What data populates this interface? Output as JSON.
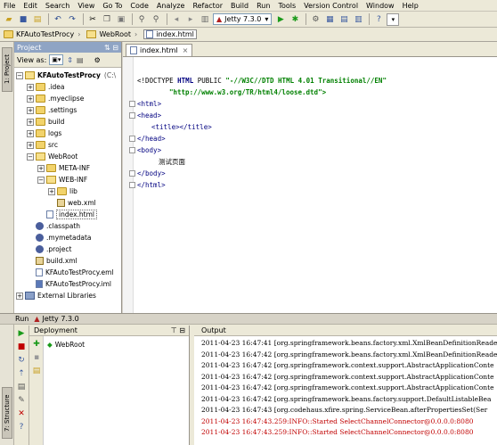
{
  "menu": [
    "File",
    "Edit",
    "Search",
    "View",
    "Go To",
    "Code",
    "Analyze",
    "Refactor",
    "Build",
    "Run",
    "Tools",
    "Version Control",
    "Window",
    "Help"
  ],
  "toolbar": {
    "run_config": "Jetty 7.3.0"
  },
  "breadcrumb": {
    "project": "KFAutoTestProcy",
    "folder": "WebRoot",
    "file": "index.html"
  },
  "sidebar": {
    "project_tab": "1: Project",
    "structure_tab": "7: Structure"
  },
  "project_panel": {
    "title": "Project",
    "view_as_label": "View as:",
    "root": "KFAutoTestProcy",
    "root_suffix": "(C:\\",
    "items": [
      ".idea",
      ".myeclipse",
      ".settings",
      "build",
      "logs",
      "src",
      "WebRoot",
      "META-INF",
      "WEB-INF",
      "lib",
      "web.xml",
      "index.html",
      ".classpath",
      ".mymetadata",
      ".project",
      "build.xml",
      "KFAutoTestProcy.eml",
      "KFAutoTestProcy.iml",
      "External Libraries"
    ]
  },
  "editor": {
    "tab": "index.html",
    "lines": {
      "doctype": "<!DOCTYPE ",
      "html_kw": "HTML",
      "public": " PUBLIC ",
      "dtd": "\"-//W3C//DTD HTML 4.01 Transitional//EN\"",
      "url": "\"http://www.w3.org/TR/html4/loose.dtd\">",
      "l3": "<html>",
      "l4": "<head>",
      "l5": "<title></title>",
      "l6": "</head>",
      "l7": "<body>",
      "l8": "测试页面",
      "l9": "</body>",
      "l10": "</html>"
    }
  },
  "run_panel": {
    "title": "Run",
    "config": "Jetty 7.3.0",
    "deployment_label": "Deployment",
    "deploy_item": "WebRoot",
    "output_label": "Output",
    "output_lines": [
      "2011-04-23 16:47:41 [org.springframework.beans.factory.xml.XmlBeanDefinitionReader",
      "2011-04-23 16:47:42 [org.springframework.beans.factory.xml.XmlBeanDefinitionReader",
      "2011-04-23 16:47:42 [org.springframework.context.support.AbstractApplicationConte",
      "2011-04-23 16:47:42 [org.springframework.context.support.AbstractApplicationConte",
      "2011-04-23 16:47:42 [org.springframework.context.support.AbstractApplicationConte",
      "2011-04-23 16:47:42 [org.springframework.beans.factory.support.DefaultListableBea",
      "2011-04-23 16:47:43 [org.codehaus.xfire.spring.ServiceBean.afterPropertiesSet(Ser",
      "2011-04-23 16:47:43.259:INFO::Started SelectChannelConnector@0.0.0.0:8080",
      "2011-04-23 16:47:43.259:INFO::Started SelectChannelConnector@0.0.0.0:8080"
    ]
  }
}
